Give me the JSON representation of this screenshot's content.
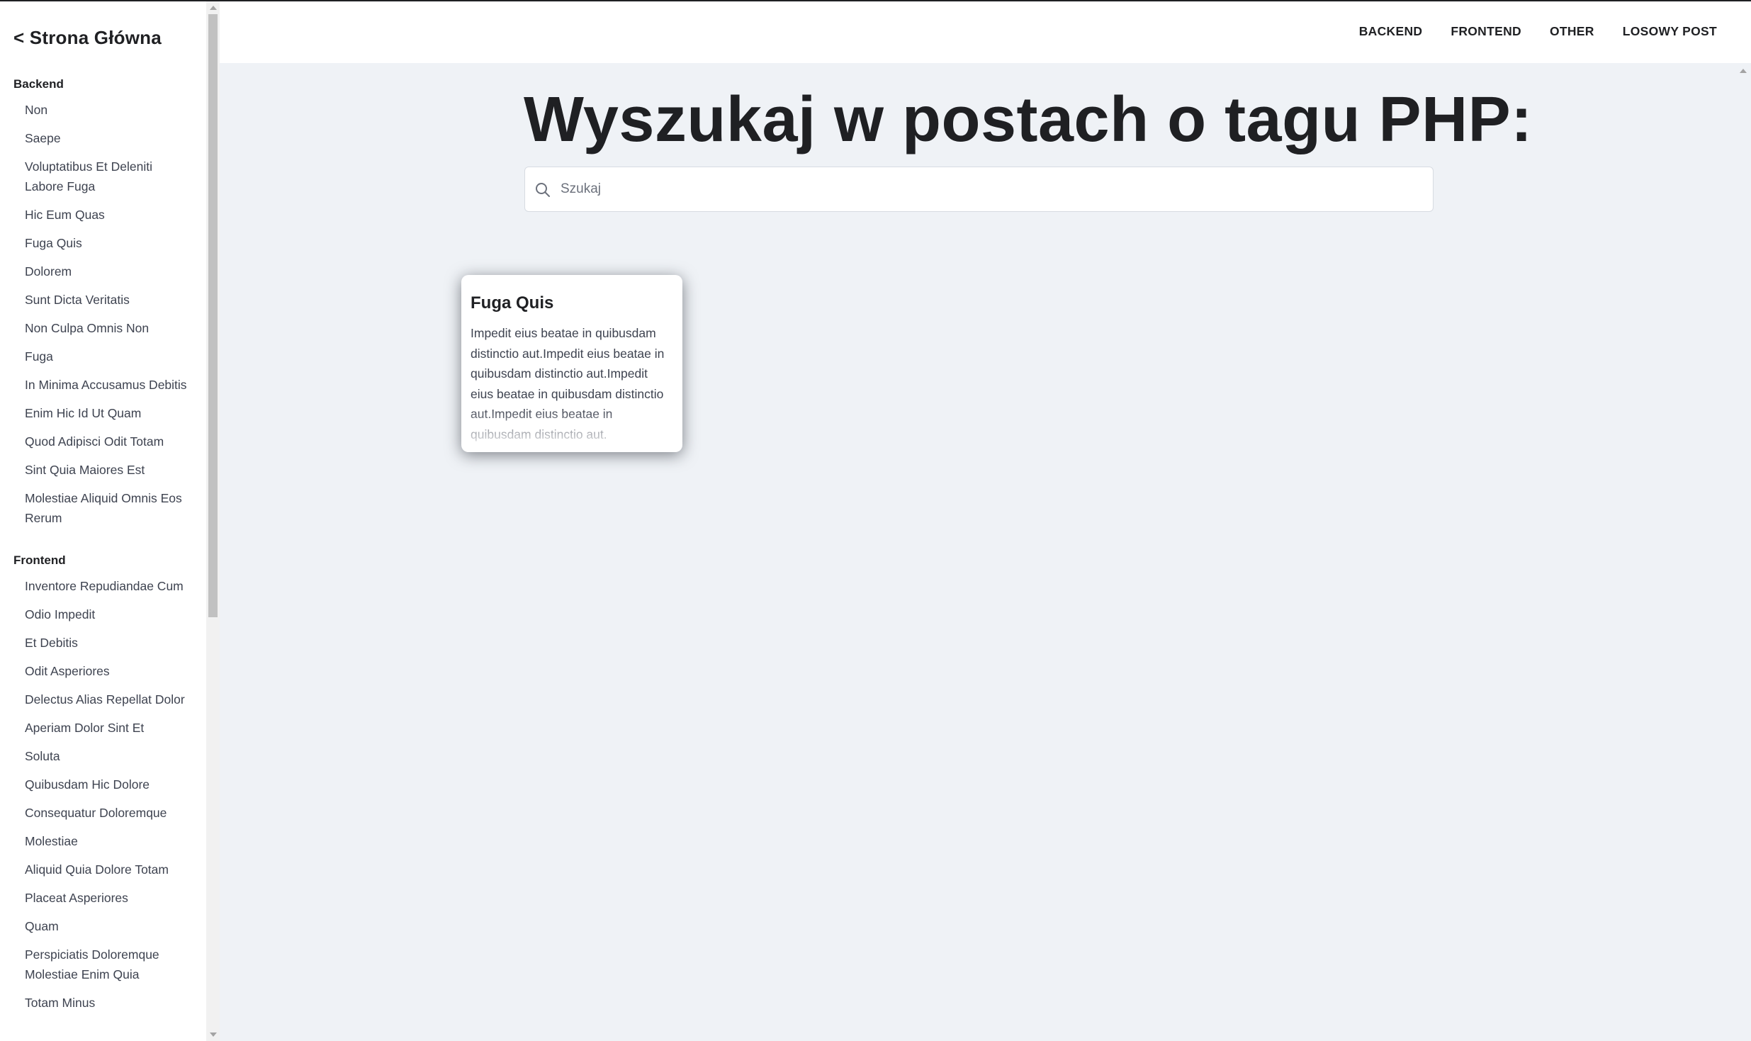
{
  "sidebar": {
    "back_link": "< Strona Główna",
    "sections": [
      {
        "title": "Backend",
        "items": [
          "Non",
          "Saepe",
          "Voluptatibus Et Deleniti Labore Fuga",
          "Hic Eum Quas",
          "Fuga Quis",
          "Dolorem",
          "Sunt Dicta Veritatis",
          "Non Culpa Omnis Non",
          "Fuga",
          "In Minima Accusamus Debitis",
          "Enim Hic Id Ut Quam",
          "Quod Adipisci Odit Totam",
          "Sint Quia Maiores Est",
          "Molestiae Aliquid Omnis Eos Rerum"
        ]
      },
      {
        "title": "Frontend",
        "items": [
          "Inventore Repudiandae Cum",
          "Odio Impedit",
          "Et Debitis",
          "Odit Asperiores",
          "Delectus Alias Repellat Dolor",
          "Aperiam Dolor Sint Et",
          "Soluta",
          "Quibusdam Hic Dolore",
          "Consequatur Doloremque",
          "Molestiae",
          "Aliquid Quia Dolore Totam",
          "Placeat Asperiores",
          "Quam",
          "Perspiciatis Doloremque Molestiae Enim Quia",
          "Totam Minus"
        ]
      }
    ]
  },
  "nav": [
    "BACKEND",
    "FRONTEND",
    "OTHER",
    "LOSOWY POST"
  ],
  "main": {
    "title": "Wyszukaj w postach o tagu PHP:",
    "search_placeholder": "Szukaj",
    "card": {
      "title": "Fuga Quis",
      "text": "Impedit eius beatae in quibusdam distinctio aut.Impedit eius beatae in quibusdam distinctio aut.Impedit eius beatae in quibusdam distinctio aut.Impedit eius beatae in quibusdam distinctio aut."
    }
  },
  "icons": {
    "search": "search-icon"
  }
}
